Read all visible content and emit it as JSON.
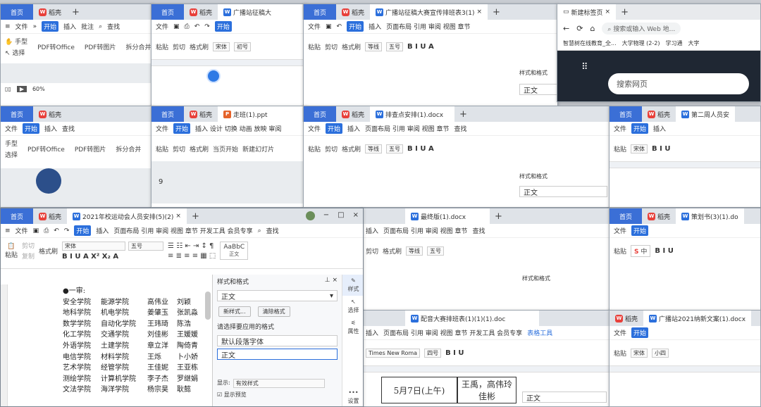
{
  "common": {
    "home": "首页",
    "app": "稻壳",
    "file": "文件",
    "start": "开始",
    "insert": "插入",
    "ribbon_word": "页面布局 引用 审阅 视图 章节",
    "ribbon_short": "页面布局 引用 审阅 视图 章节",
    "find": "查找",
    "paste": "粘贴",
    "cut": "剪切",
    "copy": "复制",
    "format_painter": "格式刷",
    "font_song": "宋体",
    "font_dengxian": "等线",
    "size_5": "五号",
    "size_small4": "小四",
    "size_4": "四号",
    "size_init": "初号",
    "styles_label": "样式和格式",
    "body_text": "正文",
    "plus": "+",
    "close": "×"
  },
  "w1": {
    "batch": "批注",
    "hand": "手型",
    "select": "选择",
    "pdf_office": "PDF转Office",
    "pdf_image": "PDF转图片",
    "split": "拆分合并",
    "zoom": "60%"
  },
  "w2": {
    "tab": "广播站征稿大"
  },
  "w3": {
    "tab": "广播站征稿大赛宣传排班表3(1)"
  },
  "browser": {
    "tab": "新建标签页",
    "address": "搜索或输入 Web 地...",
    "bm1": "智慧树在线教育_全...",
    "bm2": "大学物理 (2-2)",
    "bm3": "学习通",
    "bm4": "大字",
    "search": "搜索网页"
  },
  "w5": {
    "hand": "手型",
    "select": "选择",
    "pdf_office": "PDF转Office",
    "pdf_image": "PDF转图片",
    "split": "拆分合并"
  },
  "ppt": {
    "tab": "走班(1).ppt",
    "ribbon": "插入 设计 切换 动画 放映 审阅",
    "from_current": "当页开始",
    "new_slide": "新建幻灯片",
    "slide_num": "9"
  },
  "w7": {
    "tab": "排查点安排(1).docx"
  },
  "w8": {
    "tab": "第二周人员安"
  },
  "main": {
    "tab": "2021年校运动会人员安排(5)(2)",
    "ribbon": "页面布局 引用 审阅 视图 章节 开发工具 会员专享",
    "style_preview": "AaBbC",
    "body_label": "正文",
    "panel_title": "样式和格式",
    "current_style": "正文",
    "new_style": "新样式...",
    "clear_format": "清除格式",
    "apply_label": "请选择要应用的格式",
    "default_font": "默认段落字体",
    "body_style": "正文",
    "show_label": "显示:",
    "show_value": "有效样式",
    "preview": "显示预览",
    "side_style": "样式",
    "side_select": "选择",
    "side_attr": "属性",
    "side_settings": "设置",
    "heading": "●一审:",
    "rows": [
      [
        "安全学院",
        "能源学院",
        "高伟业",
        "刘颖"
      ],
      [
        "地科学院",
        "机电学院",
        "姜肇玉",
        "张凯淼"
      ],
      [
        "数学学院",
        "自动化学院",
        "王玮琦",
        "陈浩"
      ],
      [
        "化工学院",
        "交通学院",
        "刘佳彬",
        "王媛媛"
      ],
      [
        "外语学院",
        "土建学院",
        "章立洋",
        "陶倚青"
      ],
      [
        "电信学院",
        "材料学院",
        "王烁",
        "卜小娇"
      ],
      [
        "艺术学院",
        "经管学院",
        "王佳妮",
        "王亚栋"
      ],
      [
        "测绘学院",
        "计算机学院",
        "李子杰",
        "罗继娟"
      ],
      [
        "文法学院",
        "海洋学院",
        "杨宗昊",
        "耿懿"
      ]
    ]
  },
  "w10": {
    "tab": "最终版(1).docx"
  },
  "w11": {
    "tab": "策划书(3)(1).do"
  },
  "w12": {
    "tab": "配音大赛排班表(1)(1)(1).doc",
    "ribbon": "页面布局 引用 审阅 视图 章节 开发工具 会员专享",
    "table_tool": "表格工具",
    "font": "Times New Roma",
    "cell_date": "5月7日(上午)",
    "cell_names": "王禹，高伟玲",
    "cell_names2": "佳彬"
  },
  "w13": {
    "tab": "广播站2021纳新文案(1).docx"
  },
  "ime": {
    "label": "中"
  }
}
